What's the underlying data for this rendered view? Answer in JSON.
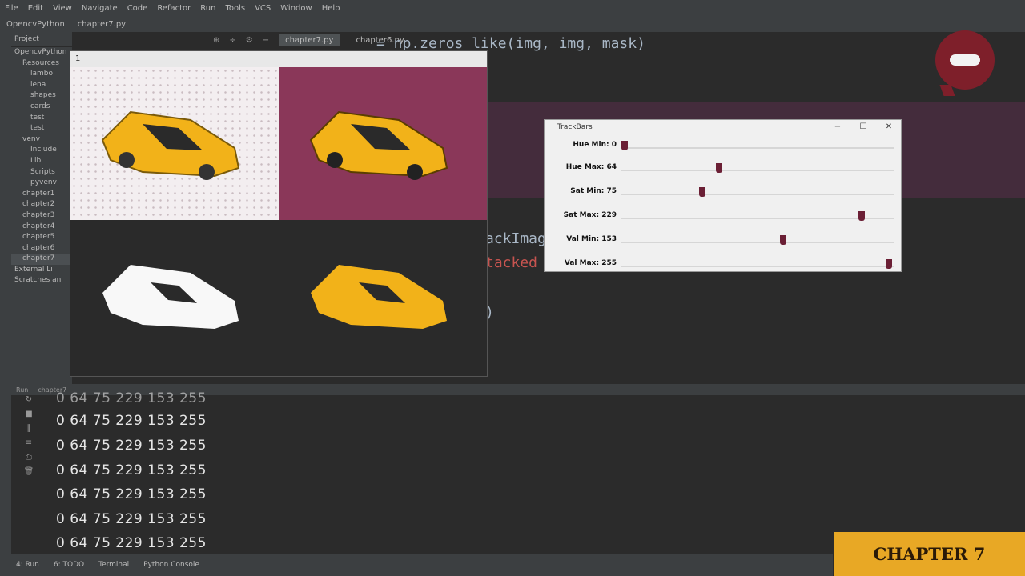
{
  "menu": [
    "File",
    "Edit",
    "View",
    "Navigate",
    "Code",
    "Refactor",
    "Run",
    "Tools",
    "VCS",
    "Window",
    "Help"
  ],
  "nav": {
    "project": "OpencvPython",
    "file": "chapter7.py"
  },
  "editor_tabs": {
    "active": "chapter7.py",
    "other": "chapter6.py"
  },
  "project_panel": {
    "header": "Project",
    "items": [
      "OpencvPython",
      "Resources",
      "lambo",
      "lena",
      "shapes",
      "cards",
      "test",
      "test",
      "venv",
      "Include",
      "Lib",
      "Scripts",
      "pyvenv",
      "chapter1",
      "chapter2",
      "chapter3",
      "chapter4",
      "chapter5",
      "chapter6",
      "chapter7",
      "External Li",
      "Scratches an"
    ]
  },
  "code": {
    "line_top": "= np.zeros_like(img, img, mask)",
    "line_a": "ackImag",
    "line_b": "tacked",
    "line_c": ")"
  },
  "image_window": {
    "title": "1"
  },
  "trackbars": {
    "title": "TrackBars",
    "rows": [
      {
        "label": "Hue Min: 0",
        "value": 0,
        "max": 179
      },
      {
        "label": "Hue Max: 64",
        "value": 64,
        "max": 179
      },
      {
        "label": "Sat Min: 75",
        "value": 75,
        "max": 255
      },
      {
        "label": "Sat Max: 229",
        "value": 229,
        "max": 255
      },
      {
        "label": "Val Min: 153",
        "value": 153,
        "max": 255
      },
      {
        "label": "Val Max: 255",
        "value": 255,
        "max": 255
      }
    ]
  },
  "run_panel": {
    "tab_run": "Run",
    "tab_name": "chapter7"
  },
  "console_lines": [
    "0 64 75 229 153 255",
    "0 64 75 229 153 255",
    "0 64 75 229 153 255",
    "0 64 75 229 153 255",
    "0 64 75 229 153 255",
    "0 64 75 229 153 255",
    "0 64 75 229 153 255"
  ],
  "status": {
    "run": "4: Run",
    "todo": "6: TODO",
    "terminal": "Terminal",
    "console": "Python Console"
  },
  "badge": "CHAPTER 7",
  "colors": {
    "car": "#f2b219",
    "mask_bg": "#2a2a2a",
    "hsv_bg": "#8a3759",
    "thumb": "#6b1f35",
    "badge": "#e8a825"
  }
}
